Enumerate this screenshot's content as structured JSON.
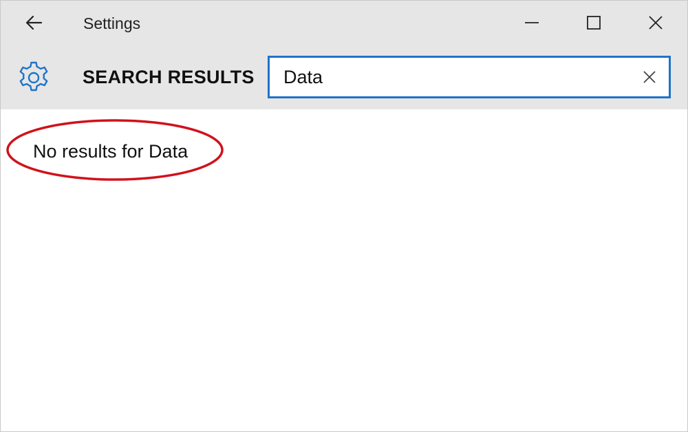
{
  "window": {
    "title": "Settings"
  },
  "controls": {
    "back_icon": "arrow-left-icon",
    "minimize_icon": "minimize-icon",
    "maximize_icon": "maximize-icon",
    "close_icon": "close-icon"
  },
  "header": {
    "icon": "gear-icon",
    "title": "SEARCH RESULTS"
  },
  "search": {
    "value": "Data",
    "clear_icon": "clear-icon",
    "border_color": "#1e73c8"
  },
  "results": {
    "message": "No results for Data",
    "annotation_color": "#d0121b"
  },
  "colors": {
    "chrome_bg": "#e6e6e6",
    "accent": "#1e73c8",
    "content_bg": "#ffffff"
  }
}
